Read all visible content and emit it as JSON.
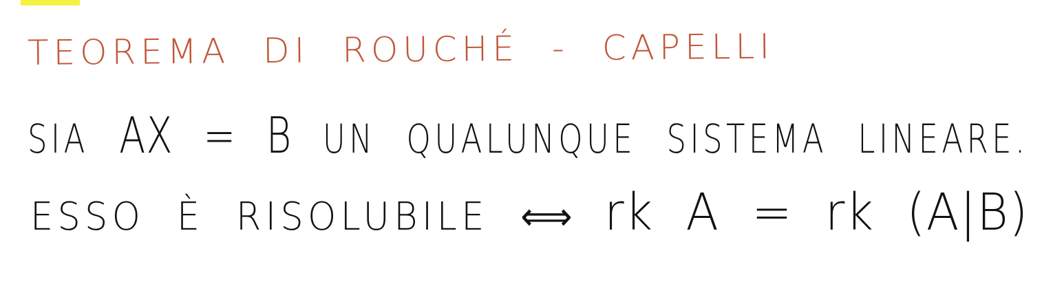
{
  "note": {
    "top_strip": {
      "pre_text": "",
      "highlight_text": "",
      "post_text": ""
    },
    "title": "TEOREMA DI ROUCHÉ - CAPELLI",
    "statement": {
      "lead": "SIA",
      "equation": "AX = B",
      "rest": "UN QUALUNQUE SISTEMA LINEARE."
    },
    "condition": {
      "text": "ESSO È RISOLUBILE",
      "arrow": "⟺",
      "formula": "rk A = rk (A|B)"
    }
  },
  "colors": {
    "title": "#c0583a",
    "ink": "#121212",
    "highlight": "#f5f242"
  }
}
